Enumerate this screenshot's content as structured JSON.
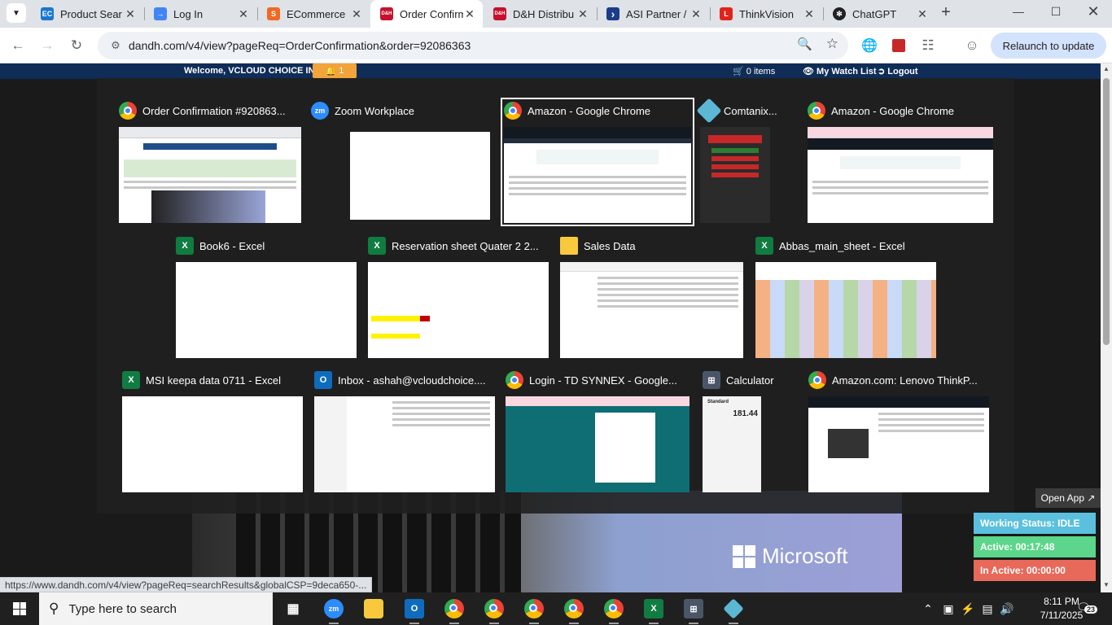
{
  "browser": {
    "tabs": [
      {
        "title": "Product Sear",
        "favicon": "EC",
        "favicon_color": "#1976d2"
      },
      {
        "title": "Log In",
        "favicon": "login-icon",
        "favicon_color": "#4285f4"
      },
      {
        "title": "ECommerce",
        "favicon": "S",
        "favicon_color": "#f06a24"
      },
      {
        "title": "Order Confirm",
        "favicon": "D&H",
        "favicon_color": "#c8102e",
        "active": true
      },
      {
        "title": "D&H Distribu",
        "favicon": "D&H",
        "favicon_color": "#c8102e"
      },
      {
        "title": "ASI Partner /",
        "favicon": "›",
        "favicon_color": "#1a3c8c"
      },
      {
        "title": "ThinkVision",
        "favicon": "L",
        "favicon_color": "#e2231a"
      },
      {
        "title": "ChatGPT",
        "favicon": "openai-icon",
        "favicon_color": "#202123"
      }
    ],
    "url": "dandh.com/v4/view?pageReq=OrderConfirmation&order=92086363",
    "relaunch_label": "Relaunch to update",
    "status_url": "https://www.dandh.com/v4/view?pageReq=searchResults&globalCSP=9deca650-..."
  },
  "page": {
    "welcome": "Welcome, VCLOUD CHOICE INC",
    "notification_count": "1",
    "cart": "0 items",
    "watch_list": "My Watch List",
    "logout": "Logout",
    "banner_brand": "Microsoft"
  },
  "switcher": {
    "windows": [
      {
        "title": "Order Confirmation #920863...",
        "app": "chrome"
      },
      {
        "title": "Zoom Workplace",
        "app": "zoom"
      },
      {
        "title": "Amazon - Google Chrome",
        "app": "chrome",
        "selected": true
      },
      {
        "title": "Comtanix...",
        "app": "comtanix"
      },
      {
        "title": "Amazon - Google Chrome",
        "app": "chrome"
      },
      {
        "title": "Book6 - Excel",
        "app": "excel"
      },
      {
        "title": "Reservation sheet Quater 2 2...",
        "app": "excel"
      },
      {
        "title": "Sales Data",
        "app": "explorer"
      },
      {
        "title": "Abbas_main_sheet - Excel",
        "app": "excel"
      },
      {
        "title": "MSI keepa data 0711 - Excel",
        "app": "excel"
      },
      {
        "title": "Inbox - ashah@vcloudchoice....",
        "app": "outlook"
      },
      {
        "title": "Login - TD SYNNEX - Google...",
        "app": "chrome"
      },
      {
        "title": "Calculator",
        "app": "calculator",
        "display": "181.44",
        "mode": "Standard"
      },
      {
        "title": "Amazon.com: Lenovo ThinkP...",
        "app": "chrome"
      }
    ]
  },
  "monitor": {
    "open_app": "Open App ↗",
    "status": "Working Status: IDLE",
    "active": "Active: 00:17:48",
    "inactive": "In Active: 00:00:00",
    "colors": {
      "status": "#5bc0de",
      "active": "#5cd68a",
      "inactive": "#e8695a"
    }
  },
  "taskbar": {
    "search_placeholder": "Type here to search",
    "time": "8:11 PM",
    "date": "7/11/2025",
    "notification_badge": "23"
  }
}
